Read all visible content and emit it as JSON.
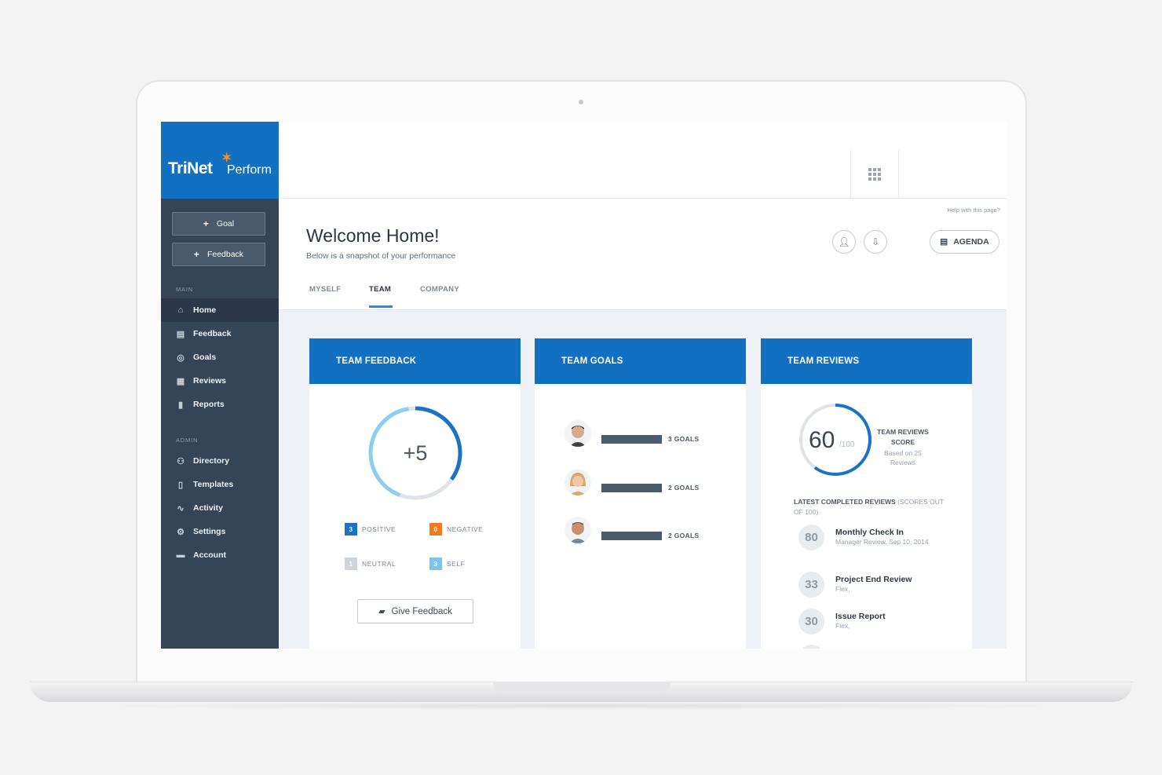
{
  "logo": {
    "part1": "TriNet",
    "part2": "Perform"
  },
  "sidebar": {
    "buttons": [
      {
        "label": "Goal"
      },
      {
        "label": "Feedback"
      }
    ],
    "main_label": "MAIN",
    "main_items": [
      {
        "label": "Home",
        "icon": "home-icon"
      },
      {
        "label": "Feedback",
        "icon": "chat-icon"
      },
      {
        "label": "Goals",
        "icon": "target-icon"
      },
      {
        "label": "Reviews",
        "icon": "calendar-icon"
      },
      {
        "label": "Reports",
        "icon": "bar-chart-icon"
      }
    ],
    "admin_label": "ADMIN",
    "admin_items": [
      {
        "label": "Directory",
        "icon": "people-icon"
      },
      {
        "label": "Templates",
        "icon": "document-icon"
      },
      {
        "label": "Activity",
        "icon": "pulse-icon"
      },
      {
        "label": "Settings",
        "icon": "gear-icon"
      },
      {
        "label": "Account",
        "icon": "card-icon"
      }
    ]
  },
  "header": {
    "help": "Help with this page?",
    "title": "Welcome Home!",
    "subtitle": "Below is a snapshot of your performance",
    "agenda": "AGENDA",
    "tabs": [
      "MYSELF",
      "TEAM",
      "COMPANY"
    ],
    "active_tab": "TEAM"
  },
  "feedback_card": {
    "title": "TEAM FEEDBACK",
    "score": "+5",
    "ring_fraction": 0.35,
    "legend": [
      {
        "count": "3",
        "label": "POSITIVE",
        "color": "#1a73c7"
      },
      {
        "count": "0",
        "label": "NEGATIVE",
        "color": "#f07a22"
      },
      {
        "count": "1",
        "label": "NEUTRAL",
        "color": "#cfd4da"
      },
      {
        "count": "3",
        "label": "SELF",
        "color": "#7fc3ea"
      }
    ],
    "button": "Give Feedback"
  },
  "goals_card": {
    "title": "TEAM GOALS",
    "members": [
      {
        "goals": "3 GOALS"
      },
      {
        "goals": "2 GOALS"
      },
      {
        "goals": "2 GOALS"
      }
    ]
  },
  "reviews_card": {
    "title": "TEAM REVIEWS",
    "score": "60",
    "score_max": "/100",
    "score_fraction": 0.6,
    "score_label": "TEAM REVIEWS SCORE",
    "score_sub": "Based on 25 Reviews",
    "latest_heading": "LATEST COMPLETED REVIEWS",
    "latest_note": "(SCORES OUT OF 100)",
    "reviews": [
      {
        "score": "80",
        "title": "Monthly Check In",
        "sub": "Manager Review, Sep 10, 2014"
      },
      {
        "score": "33",
        "title": "Project End Review",
        "sub": "Flex,"
      },
      {
        "score": "30",
        "title": "Issue Report",
        "sub": "Flex,"
      }
    ]
  },
  "colors": {
    "brand": "#1170c2",
    "sidebar": "#364556",
    "accent": "#2a8ad6",
    "orange": "#f39227"
  }
}
